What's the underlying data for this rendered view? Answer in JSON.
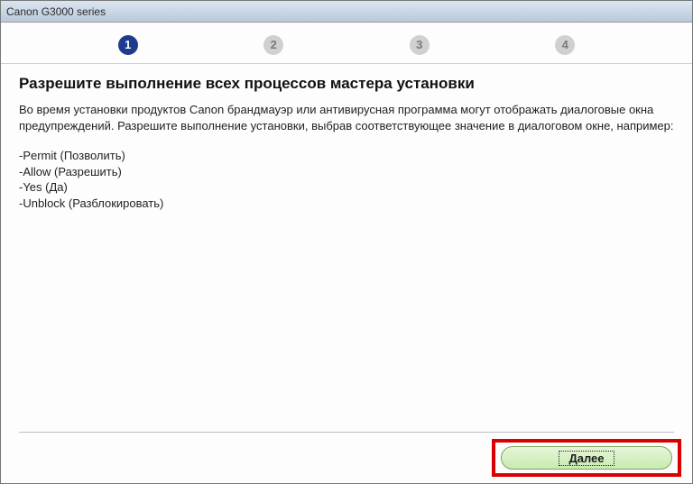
{
  "window": {
    "title": "Canon G3000 series"
  },
  "steps": {
    "s1": "1",
    "s2": "2",
    "s3": "3",
    "s4": "4"
  },
  "content": {
    "heading": "Разрешите выполнение всех процессов мастера установки",
    "body": "Во время установки продуктов Canon брандмауэр или антивирусная программа могут отображать диалоговые окна предупреждений. Разрешите выполнение установки, выбрав соответствующее значение в диалоговом окне, например:",
    "options": {
      "o1": "-Permit (Позволить)",
      "o2": "-Allow (Разрешить)",
      "o3": "-Yes (Да)",
      "o4": "-Unblock (Разблокировать)"
    }
  },
  "footer": {
    "next_label": "Далее"
  }
}
